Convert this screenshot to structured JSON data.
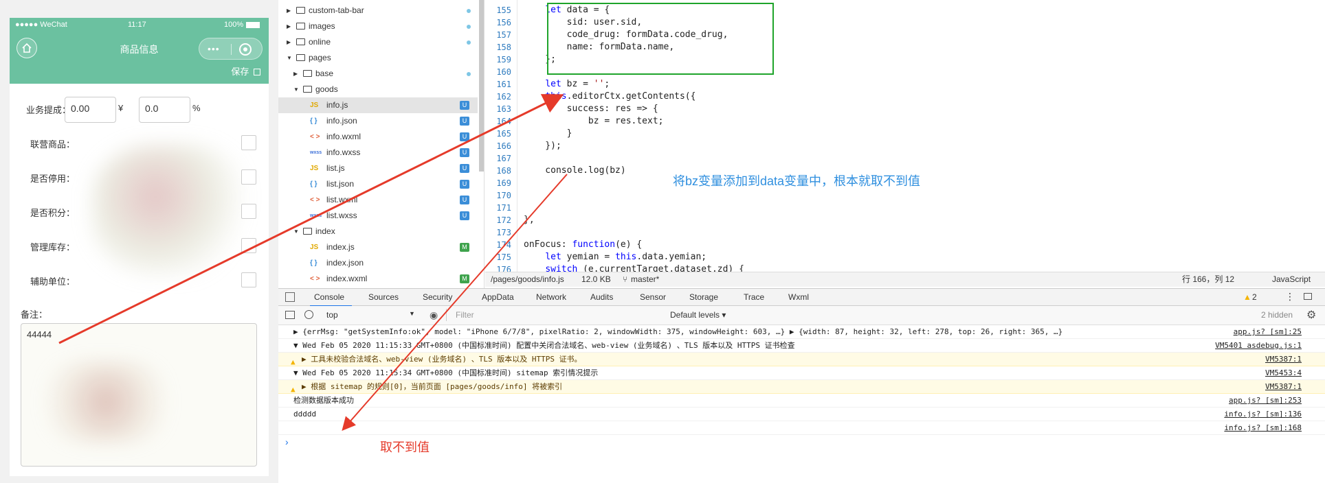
{
  "phone": {
    "status": {
      "carrier": "●●●●● WeChat",
      "time": "11:17",
      "battery": "100%"
    },
    "nav_title": "商品信息",
    "capsule_dots": "•••",
    "save_label": "保存",
    "fields": [
      {
        "label": "业务提成：",
        "value1": "0.00",
        "currency": "¥",
        "value2": "0.0",
        "unit": "%"
      },
      {
        "label": "联营商品："
      },
      {
        "label": "是否停用："
      },
      {
        "label": "是否积分："
      },
      {
        "label": "管理库存："
      },
      {
        "label": "辅助单位："
      }
    ],
    "remark_label": "备注：",
    "remark_value": "44444"
  },
  "tree": {
    "items": [
      {
        "label": "custom-tab-bar",
        "type": "folder",
        "indent": 1,
        "expanded": false,
        "dot": true
      },
      {
        "label": "images",
        "type": "folder",
        "indent": 1,
        "expanded": false,
        "dot": true
      },
      {
        "label": "online",
        "type": "folder",
        "indent": 1,
        "expanded": false,
        "dot": true
      },
      {
        "label": "pages",
        "type": "folder",
        "indent": 1,
        "expanded": true,
        "dot": false
      },
      {
        "label": "base",
        "type": "folder",
        "indent": 2,
        "expanded": false,
        "dot": true
      },
      {
        "label": "goods",
        "type": "folder",
        "indent": 2,
        "expanded": true,
        "dot": false
      },
      {
        "label": "info.js",
        "type": "js",
        "indent": 3,
        "badge": "U",
        "selected": true
      },
      {
        "label": "info.json",
        "type": "json",
        "indent": 3,
        "badge": "U"
      },
      {
        "label": "info.wxml",
        "type": "wxml",
        "indent": 3,
        "badge": "U"
      },
      {
        "label": "info.wxss",
        "type": "wxss",
        "indent": 3,
        "badge": "U"
      },
      {
        "label": "list.js",
        "type": "js",
        "indent": 3,
        "badge": "U"
      },
      {
        "label": "list.json",
        "type": "json",
        "indent": 3,
        "badge": "U"
      },
      {
        "label": "list.wxml",
        "type": "wxml",
        "indent": 3,
        "badge": "U"
      },
      {
        "label": "list.wxss",
        "type": "wxss",
        "indent": 3,
        "badge": "U"
      },
      {
        "label": "index",
        "type": "folder",
        "indent": 2,
        "expanded": true,
        "dot": false
      },
      {
        "label": "index.js",
        "type": "js",
        "indent": 3,
        "badge": "M"
      },
      {
        "label": "index.json",
        "type": "json",
        "indent": 3,
        "badge": ""
      },
      {
        "label": "index.wxml",
        "type": "wxml",
        "indent": 3,
        "badge": "M"
      }
    ],
    "icons": {
      "js": "JS",
      "json": "{ }",
      "wxml": "< >",
      "wxss": "wxss"
    }
  },
  "editor": {
    "lines": [
      {
        "n": "155",
        "code": "    let data = {"
      },
      {
        "n": "156",
        "code": "        sid: user.sid,"
      },
      {
        "n": "157",
        "code": "        code_drug: formData.code_drug,"
      },
      {
        "n": "158",
        "code": "        name: formData.name,"
      },
      {
        "n": "159",
        "code": "    };"
      },
      {
        "n": "160",
        "code": ""
      },
      {
        "n": "161",
        "code": "    let bz = '';"
      },
      {
        "n": "162",
        "code": "    this.editorCtx.getContents({"
      },
      {
        "n": "163",
        "code": "        success: res => {"
      },
      {
        "n": "164",
        "code": "            bz = res.text;"
      },
      {
        "n": "165",
        "code": "        }"
      },
      {
        "n": "166",
        "code": "    });"
      },
      {
        "n": "167",
        "code": ""
      },
      {
        "n": "168",
        "code": "    console.log(bz)"
      },
      {
        "n": "169",
        "code": ""
      },
      {
        "n": "170",
        "code": ""
      },
      {
        "n": "171",
        "code": ""
      },
      {
        "n": "172",
        "code": "},"
      },
      {
        "n": "173",
        "code": ""
      },
      {
        "n": "174",
        "code": "onFocus: function(e) {"
      },
      {
        "n": "175",
        "code": "    let yemian = this.data.yemian;"
      },
      {
        "n": "176",
        "code": "    switch (e.currentTarget.dataset.zd) {"
      }
    ],
    "annotation_blue": "将bz变量添加到data变量中，根本就取不到值",
    "annotation_red": "取不到值"
  },
  "editor_status": {
    "path": "/pages/goods/info.js",
    "size": "12.0 KB",
    "branch": "master*",
    "cursor": "行 166，列 12",
    "lang": "JavaScript"
  },
  "devtools": {
    "tabs": [
      "Console",
      "Sources",
      "Security",
      "AppData",
      "Network",
      "Audits",
      "Sensor",
      "Storage",
      "Trace",
      "Wxml"
    ],
    "active_tab": "Console",
    "warn_count": "2",
    "context": "top",
    "filter_placeholder": "Filter",
    "levels": "Default levels ▾",
    "hidden": "2 hidden",
    "rows": [
      {
        "text": "▶ {errMsg: \"getSystemInfo:ok\", model: \"iPhone 6/7/8\", pixelRatio: 2, windowWidth: 375, windowHeight: 603, …} ▶ {width: 87, height: 32, left: 278, top: 26, right: 365, …}",
        "src": "app.js? [sm]:25",
        "warn": false
      },
      {
        "text": "▼ Wed Feb 05 2020 11:15:33 GMT+0800 (中国标准时间) 配置中关闭合法域名、web-view (业务域名) 、TLS 版本以及 HTTPS 证书检查",
        "src": "VM5401 asdebug.js:1",
        "warn": false
      },
      {
        "text": "▶ 工具未校验合法域名、web-view (业务域名) 、TLS 版本以及 HTTPS 证书。",
        "src": "VM5387:1",
        "warn": true
      },
      {
        "text": "▼ Wed Feb 05 2020 11:15:34 GMT+0800 (中国标准时间) sitemap 索引情况提示",
        "src": "VM5453:4",
        "warn": false
      },
      {
        "text": "▶ 根据 sitemap 的规则[0]，当前页面 [pages/goods/info] 将被索引",
        "src": "VM5387:1",
        "warn": true
      },
      {
        "text": "检测数据版本成功",
        "src": "app.js? [sm]:253",
        "warn": false
      },
      {
        "text": "ddddd",
        "src": "info.js? [sm]:136",
        "warn": false
      },
      {
        "text": "",
        "src": "info.js? [sm]:168",
        "warn": false
      }
    ],
    "prompt": "›"
  }
}
